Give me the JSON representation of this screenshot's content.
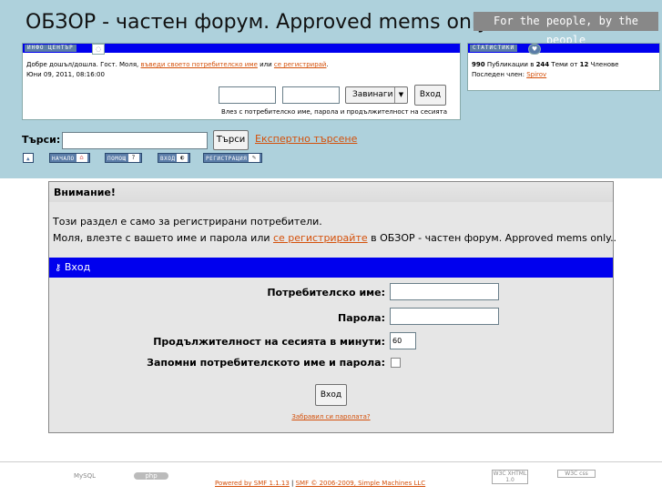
{
  "header": {
    "title": "ОБЗОР - частен форум. Approved mems only.",
    "slogan": "For the people, by the people"
  },
  "info_center": {
    "tab_label": "ИНФО ЦЕНТЪР",
    "welcome_prefix": "Добре дошъл/дошла. Гост. Моля, ",
    "login_link": "въведи своето потребителско име",
    "or_text": " или ",
    "register_link": "се регистрирай",
    "period": ".",
    "date": "Юни 09, 2011, 08:16:00",
    "username_value": "",
    "password_value": "",
    "duration_select": "Завинаги",
    "login_button": "Вход",
    "hint": "Влез с потребителско име, парола и продължителност на сесията"
  },
  "stats": {
    "tab_label": "СТАТИСТИКИ",
    "posts": "990",
    "posts_text": " Публикации в ",
    "topics": "244",
    "topics_text": " Теми от ",
    "members": "12",
    "members_text": " Членове",
    "latest_label": "Последен член: ",
    "latest_member": "Spirov"
  },
  "search": {
    "label": "Търси:",
    "value": "",
    "button": "Търси",
    "advanced": "Експертно търсене"
  },
  "nav": {
    "home": "НАЧАЛО",
    "help": "ПОМОЩ",
    "login": "ВХОД",
    "register": "РЕГИСТРАЦИЯ"
  },
  "notice": {
    "title": "Внимание!",
    "line1": "Този раздел е само за регистрирани потребители.",
    "line2_prefix": "Моля, влезте с вашето име и парола или ",
    "line2_link": "се регистрирайте",
    "line2_suffix": " в ОБЗОР - частен форум. Approved mems only.."
  },
  "login_form": {
    "bar_title": "Вход",
    "username_label": "Потребителско име:",
    "password_label": "Парола:",
    "session_label": "Продължителност на сесията в минути:",
    "session_value": "60",
    "remember_label": "Запомни потребителското име и парола:",
    "submit": "Вход",
    "forgot": "Забравил си паролата?"
  },
  "footer": {
    "mysql": "MySQL",
    "php": "php",
    "powered": "Powered by SMF 1.1.13",
    "sep": " | ",
    "copyright": "SMF © 2006-2009, Simple Machines LLC",
    "xhtml": "W3C XHTML 1.0",
    "css": "W3C css"
  },
  "colors": {
    "header_bg": "#aed1dc",
    "bar_blue": "#0000ee",
    "link_orange": "#d4500a"
  }
}
